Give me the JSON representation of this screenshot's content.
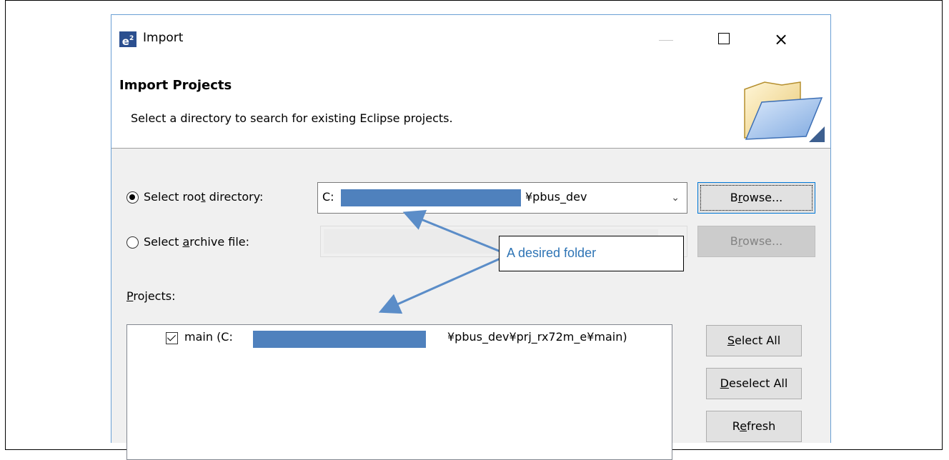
{
  "window": {
    "app_icon_text": "e",
    "app_icon_sup": "2",
    "title": "Import",
    "controls": {
      "minimize": "—",
      "maximize": "□",
      "close": "×"
    }
  },
  "header": {
    "title": "Import Projects",
    "description": "Select a directory to search for existing Eclipse projects.",
    "icon": "folder-icon"
  },
  "root_directory": {
    "label_pre": "Select roo",
    "label_u": "t",
    "label_post": " directory:",
    "selected": true,
    "value_prefix": "C:",
    "value_suffix": "¥pbus_dev",
    "browse": {
      "pre": "B",
      "u": "r",
      "post": "owse..."
    }
  },
  "archive_file": {
    "label_pre": "Select ",
    "label_u": "a",
    "label_post": "rchive file:",
    "selected": false,
    "value": "",
    "browse": {
      "pre": "B",
      "u": "r",
      "post": "owse..."
    }
  },
  "projects": {
    "label_u": "P",
    "label_post": "rojects:",
    "items": [
      {
        "checked": true,
        "prefix": "main (C:",
        "suffix": "¥pbus_dev¥prj_rx72m_e¥main)"
      }
    ]
  },
  "buttons": {
    "select_all": {
      "u": "S",
      "post": "elect All"
    },
    "deselect_all": {
      "u": "D",
      "post": "eselect All"
    },
    "refresh": {
      "pre": "R",
      "u": "e",
      "post": "fresh"
    }
  },
  "annotation": {
    "text": "A desired folder",
    "text_color": "#2e74b5",
    "arrow_color": "#5b8dc8"
  },
  "colors": {
    "redaction": "#4f81bd",
    "dialog_bg": "#f0f0f0",
    "focus_border": "#0078d7"
  }
}
